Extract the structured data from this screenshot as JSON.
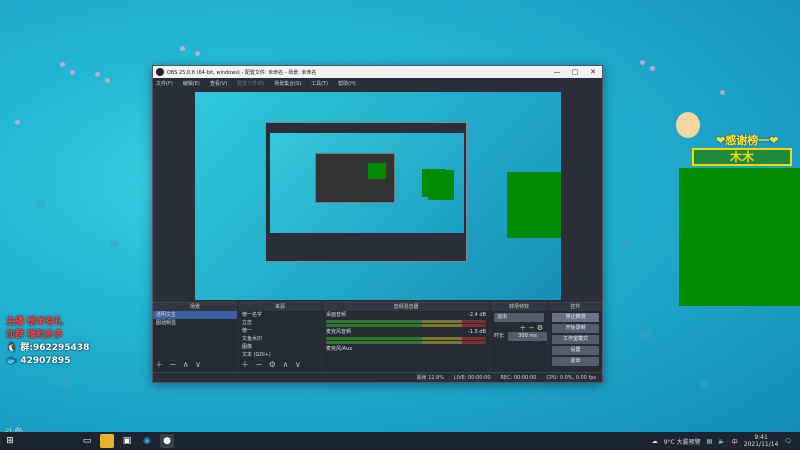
{
  "window": {
    "title": "OBS 25.0.8 (64-bit, windows) - 配置文件: 未命名 - 场景: 未命名",
    "controls": [
      "—",
      "▢",
      "✕"
    ]
  },
  "menubar": [
    "文件(F)",
    "编辑(E)",
    "查看(V)",
    "配置文件(P)",
    "场景集合(S)",
    "工具(T)",
    "帮助(H)"
  ],
  "docks": {
    "scenes": {
      "title": "场景",
      "items": [
        "透明文生",
        "图涵频显"
      ]
    },
    "sources": {
      "title": "来源",
      "items": [
        "榜一名字",
        "立志",
        "榜一",
        "文鱼水印",
        "图像",
        "文本 (GDI+)"
      ]
    },
    "mixer": {
      "title": "音频混音器",
      "channels": [
        {
          "name": "桌面音频",
          "db": "-2.4 dB"
        },
        {
          "name": "麦克风音频",
          "db": "-1.5 dB"
        },
        {
          "name": "麦克风/Aux",
          "db": ""
        }
      ]
    },
    "transitions": {
      "title": "转场特效",
      "type": "淡出",
      "duration_label": "时长",
      "duration": "300 ms"
    },
    "controls": {
      "title": "控件",
      "buttons": [
        "停止推流",
        "开始录制",
        "工作室模式",
        "设置",
        "退出"
      ]
    }
  },
  "statusbar": {
    "dropped": "丢帧 12.8%",
    "live": "LIVE: 00:00:00",
    "rec": "REC: 00:00:00",
    "cpu": "CPU: 0.0%, 0.00 fps"
  },
  "overlay": {
    "line1": "主播 榜单有礼",
    "line2": "加群 福利多多",
    "qq_label": "群:",
    "qq": "962295438",
    "fans": "42907895",
    "thanks": "❤感谢榜一❤",
    "name": "木木",
    "watermark": "斗鱼"
  },
  "taskbar": {
    "weather": "9°C 大雾预警",
    "lang": "中",
    "time": "9:41",
    "date": "2021/11/14"
  },
  "colors": {
    "green": "#028a02",
    "obs_bg": "#2b2e38",
    "desktop": "#22b6d4"
  }
}
